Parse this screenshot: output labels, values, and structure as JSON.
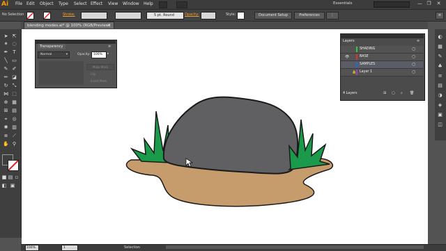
{
  "app": {
    "logo": "Ai",
    "accent": "#ff9a00"
  },
  "menu": [
    "File",
    "Edit",
    "Object",
    "Type",
    "Select",
    "Effect",
    "View",
    "Window",
    "Help"
  ],
  "workspace": {
    "label": "Essentials"
  },
  "window_controls": {
    "minimize": "—",
    "restore": "❐",
    "close": "✕"
  },
  "control_bar": {
    "selection_label": "No Selection",
    "stroke_label": "Stroke:",
    "stroke_profile": "5 pt. Round",
    "opacity_label": "Opacity:",
    "style_label": "Style:",
    "document_setup": "Document Setup",
    "preferences": "Preferences"
  },
  "document_tab": {
    "title": "blending modes.ai* @ 100% (RGB/Preview)",
    "close": "✕"
  },
  "transparency_panel": {
    "title": "Transparency",
    "blend_mode": "Normal",
    "opacity_label": "Opacity:",
    "opacity_value": "100%",
    "make_mask": "Make Mask",
    "clip": "Clip",
    "invert_mask": "Invert Mask"
  },
  "layers_panel": {
    "title": "Layers",
    "layers": [
      {
        "name": "SHADING",
        "color": "#2ecc40"
      },
      {
        "name": "BASE",
        "color": "#e03030"
      },
      {
        "name": "SAMPLES",
        "color": "#3060e0"
      },
      {
        "name": "Layer 1",
        "color": "#a040c0"
      }
    ],
    "count": "4 Layers"
  },
  "status_bar": {
    "zoom": "100%",
    "page": "1",
    "tool": "Selection"
  },
  "colors": {
    "grass": "#1a9a4a",
    "rock": "#606062",
    "ground": "#c69c6d"
  }
}
